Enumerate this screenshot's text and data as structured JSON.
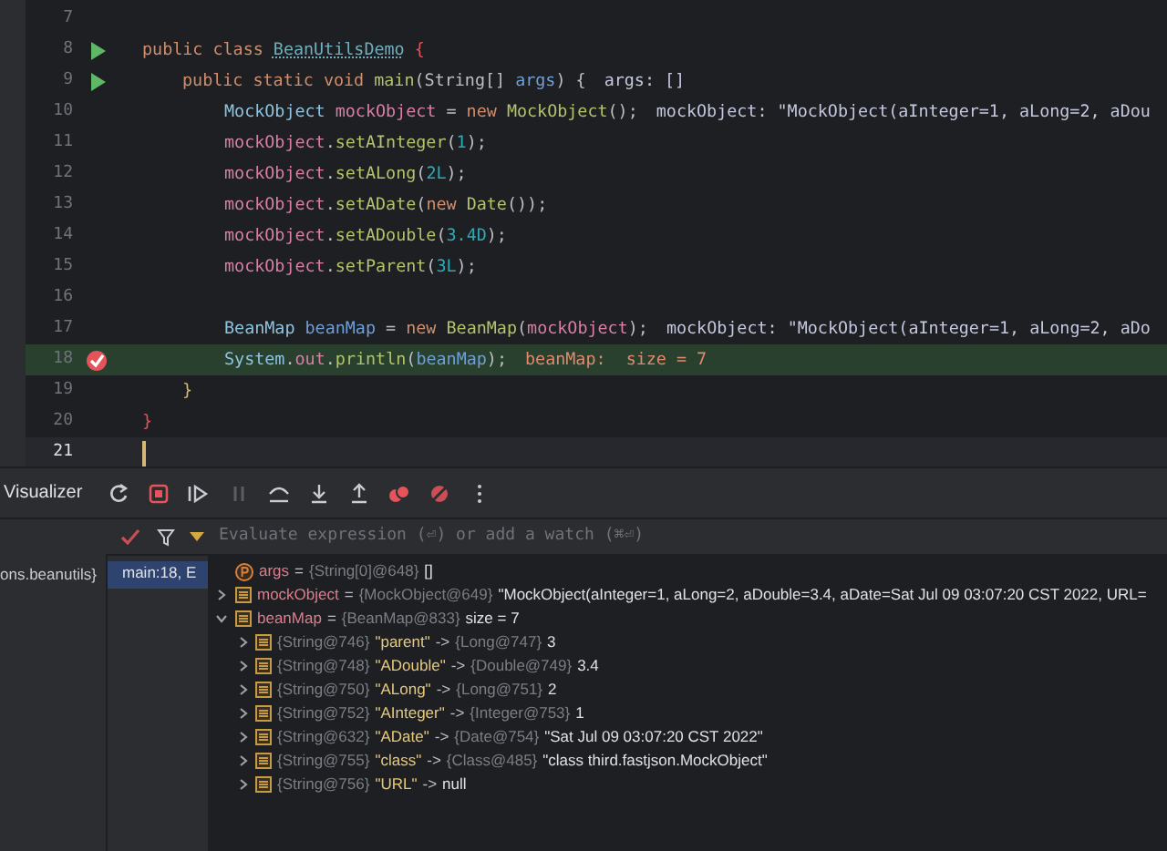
{
  "editor": {
    "lines": [
      {
        "number": "7"
      },
      {
        "number": "8",
        "run_marker": true,
        "kind": "class",
        "tokens": [
          {
            "text": "public class ",
            "kind": "kw"
          },
          {
            "text": "BeanUtilsDemo",
            "kind": "classdecl"
          },
          {
            "text": " {",
            "kind": "brace"
          }
        ]
      },
      {
        "number": "9",
        "run_marker": true,
        "kind": "method",
        "tokens": [
          {
            "text": "public static void ",
            "kind": "kw"
          },
          {
            "text": "main",
            "kind": "method"
          },
          {
            "text": "(String[] ",
            "kind": "plain"
          },
          {
            "text": "args",
            "kind": "param"
          },
          {
            "text": ") {",
            "kind": "plain"
          }
        ],
        "hint": "args: []"
      },
      {
        "number": "10",
        "kind": "body",
        "tokens": [
          {
            "text": "MockObject ",
            "kind": "cls"
          },
          {
            "text": "mockObject",
            "kind": "var"
          },
          {
            "text": " = ",
            "kind": "plain"
          },
          {
            "text": "new ",
            "kind": "kw"
          },
          {
            "text": "MockObject",
            "kind": "method"
          },
          {
            "text": "();",
            "kind": "plain"
          }
        ],
        "hint": "mockObject: \"MockObject(aInteger=1, aLong=2, aDou"
      },
      {
        "number": "11",
        "kind": "body",
        "tokens": [
          {
            "text": "mockObject",
            "kind": "var"
          },
          {
            "text": ".",
            "kind": "plain"
          },
          {
            "text": "setAInteger",
            "kind": "method"
          },
          {
            "text": "(",
            "kind": "plain"
          },
          {
            "text": "1",
            "kind": "num"
          },
          {
            "text": ");",
            "kind": "plain"
          }
        ]
      },
      {
        "number": "12",
        "kind": "body",
        "tokens": [
          {
            "text": "mockObject",
            "kind": "var"
          },
          {
            "text": ".",
            "kind": "plain"
          },
          {
            "text": "setALong",
            "kind": "method"
          },
          {
            "text": "(",
            "kind": "plain"
          },
          {
            "text": "2L",
            "kind": "num"
          },
          {
            "text": ");",
            "kind": "plain"
          }
        ]
      },
      {
        "number": "13",
        "kind": "body",
        "tokens": [
          {
            "text": "mockObject",
            "kind": "var"
          },
          {
            "text": ".",
            "kind": "plain"
          },
          {
            "text": "setADate",
            "kind": "method"
          },
          {
            "text": "(",
            "kind": "plain"
          },
          {
            "text": "new ",
            "kind": "kw"
          },
          {
            "text": "Date",
            "kind": "method"
          },
          {
            "text": "());",
            "kind": "plain"
          }
        ]
      },
      {
        "number": "14",
        "kind": "body",
        "tokens": [
          {
            "text": "mockObject",
            "kind": "var"
          },
          {
            "text": ".",
            "kind": "plain"
          },
          {
            "text": "setADouble",
            "kind": "method"
          },
          {
            "text": "(",
            "kind": "plain"
          },
          {
            "text": "3.4D",
            "kind": "num"
          },
          {
            "text": ");",
            "kind": "plain"
          }
        ]
      },
      {
        "number": "15",
        "kind": "body",
        "tokens": [
          {
            "text": "mockObject",
            "kind": "var"
          },
          {
            "text": ".",
            "kind": "plain"
          },
          {
            "text": "setParent",
            "kind": "method"
          },
          {
            "text": "(",
            "kind": "plain"
          },
          {
            "text": "3L",
            "kind": "num"
          },
          {
            "text": ");",
            "kind": "plain"
          }
        ]
      },
      {
        "number": "16"
      },
      {
        "number": "17",
        "kind": "body",
        "tokens": [
          {
            "text": "BeanMap ",
            "kind": "cls"
          },
          {
            "text": "beanMap",
            "kind": "param"
          },
          {
            "text": " = ",
            "kind": "plain"
          },
          {
            "text": "new ",
            "kind": "kw"
          },
          {
            "text": "BeanMap",
            "kind": "method"
          },
          {
            "text": "(",
            "kind": "plain"
          },
          {
            "text": "mockObject",
            "kind": "var"
          },
          {
            "text": ");",
            "kind": "plain"
          }
        ],
        "hint": "mockObject: \"MockObject(aInteger=1, aLong=2, aDo"
      },
      {
        "number": "18",
        "breakpoint": true,
        "highlighted": true,
        "kind": "body",
        "tokens": [
          {
            "text": "System",
            "kind": "cls"
          },
          {
            "text": ".",
            "kind": "plain"
          },
          {
            "text": "out",
            "kind": "var"
          },
          {
            "text": ".",
            "kind": "plain"
          },
          {
            "text": "println",
            "kind": "method"
          },
          {
            "text": "(",
            "kind": "plain"
          },
          {
            "text": "beanMap",
            "kind": "param"
          },
          {
            "text": ");",
            "kind": "plain"
          }
        ],
        "hint": "beanMap:  size = 7"
      },
      {
        "number": "19",
        "kind": "method",
        "tokens": [
          {
            "text": "}",
            "kind": "brace2"
          }
        ]
      },
      {
        "number": "20",
        "kind": "class",
        "tokens": [
          {
            "text": "}",
            "kind": "brace"
          }
        ]
      },
      {
        "number": "21",
        "current": true
      }
    ]
  },
  "debugger": {
    "label": "Visualizer",
    "context": "ons.beanutils}",
    "frames": [
      {
        "label": "main:18, E",
        "selected": true
      }
    ],
    "watch_placeholder": "Evaluate expression (⏎) or add a watch (⌘⏎)",
    "variables": [
      {
        "kind": "param",
        "name": "args",
        "equals": "=",
        "type": "{String[0]@648}",
        "value": "[]"
      },
      {
        "kind": "object",
        "name": "mockObject",
        "equals": "=",
        "type": "{MockObject@649}",
        "value": "\"MockObject(aInteger=1, aLong=2, aDouble=3.4, aDate=Sat Jul 09 03:07:20 CST 2022, URL=",
        "expanded": false
      },
      {
        "kind": "object",
        "name": "beanMap",
        "equals": "=",
        "type": "{BeanMap@833}",
        "value": "size = 7",
        "expanded": true,
        "children": [
          {
            "key_type": "{String@746}",
            "key": "\"parent\"",
            "arrow": "->",
            "value_type": "{Long@747}",
            "value": "3"
          },
          {
            "key_type": "{String@748}",
            "key": "\"ADouble\"",
            "arrow": "->",
            "value_type": "{Double@749}",
            "value": "3.4"
          },
          {
            "key_type": "{String@750}",
            "key": "\"ALong\"",
            "arrow": "->",
            "value_type": "{Long@751}",
            "value": "2"
          },
          {
            "key_type": "{String@752}",
            "key": "\"AInteger\"",
            "arrow": "->",
            "value_type": "{Integer@753}",
            "value": "1"
          },
          {
            "key_type": "{String@632}",
            "key": "\"ADate\"",
            "arrow": "->",
            "value_type": "{Date@754}",
            "value": "\"Sat Jul 09 03:07:20 CST 2022\""
          },
          {
            "key_type": "{String@755}",
            "key": "\"class\"",
            "arrow": "->",
            "value_type": "{Class@485}",
            "value": "\"class third.fastjson.MockObject\""
          },
          {
            "key_type": "{String@756}",
            "key": "\"URL\"",
            "arrow": "->",
            "value": "null"
          }
        ]
      }
    ]
  }
}
